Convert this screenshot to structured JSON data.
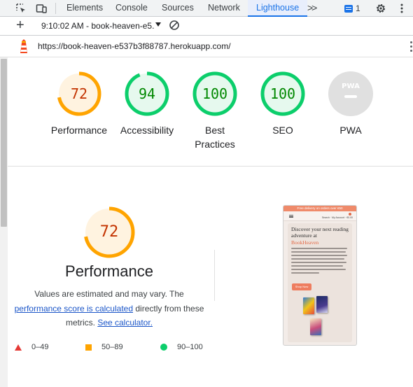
{
  "devtools": {
    "tabs": [
      "Elements",
      "Console",
      "Sources",
      "Network",
      "Lighthouse"
    ],
    "active_tab": "Lighthouse",
    "more_tabs_label": ">>",
    "issues_count": "1"
  },
  "toolbar": {
    "report_label": "9:10:02 AM - book-heaven-e5."
  },
  "url_bar": {
    "url": "https://book-heaven-e537b3f88787.herokuapp.com/"
  },
  "gauges": [
    {
      "label": "Performance",
      "score": "72",
      "value": 72,
      "status": "average"
    },
    {
      "label": "Accessibility",
      "score": "94",
      "value": 94,
      "status": "pass"
    },
    {
      "label": "Best Practices",
      "score": "100",
      "value": 100,
      "status": "pass"
    },
    {
      "label": "SEO",
      "score": "100",
      "value": 100,
      "status": "pass"
    },
    {
      "label": "PWA",
      "score": "",
      "value": null,
      "status": "na",
      "badge": "PWA"
    }
  ],
  "performance": {
    "score": "72",
    "value": 72,
    "title": "Performance",
    "desc_part1": "Values are estimated and may vary. The",
    "desc_link1": "performance score is calculated",
    "desc_part2": "directly from these metrics.",
    "desc_link2": "See calculator."
  },
  "legend": [
    {
      "range": "0–49",
      "shape": "triangle",
      "color": "#e53935"
    },
    {
      "range": "50–89",
      "shape": "square",
      "color": "#ffa400"
    },
    {
      "range": "90–100",
      "shape": "circle",
      "color": "#0cce6b"
    }
  ],
  "thumbnail": {
    "banner": "Free delivery on orders over €50",
    "nav_links": "Search · My Account · €0.00",
    "heading": "Discover your next reading adventure at",
    "brand": "BookHeaven",
    "button": "Shop Now"
  },
  "colors": {
    "average": "#ffa400",
    "average_text": "#c33300",
    "average_fill": "#fff3e0",
    "pass": "#0cce6b",
    "pass_text": "#008800",
    "pass_fill": "#e6f9ee",
    "na": "#e0e0e0",
    "link": "#1a55c8",
    "accent": "#1a73e8"
  },
  "icons": {
    "inspect": "select-element-icon",
    "device": "device-toolbar-icon",
    "issues": "issues-icon",
    "settings": "gear-icon",
    "menu": "kebab-menu-icon",
    "new_report": "plus-icon",
    "clear": "clear-icon",
    "lighthouse": "lighthouse-icon"
  }
}
